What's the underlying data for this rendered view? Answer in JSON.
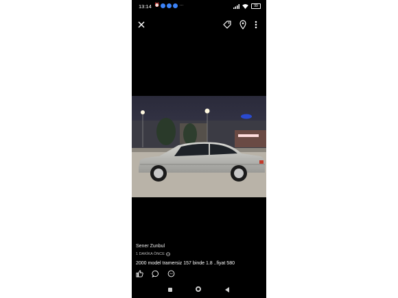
{
  "status_bar": {
    "time": "13:14",
    "battery": "99",
    "more_dots": "···"
  },
  "post": {
    "author": "Sener Zunbul",
    "timestamp": "1 DAKİKA ÖNCE",
    "caption": "2000 model tramersiz 157 binde 1.8 ..fiyat 580"
  },
  "icons": {
    "close": "close-icon",
    "tag": "tag-icon",
    "location": "location-pin-icon",
    "more": "more-vertical-icon",
    "like": "thumbs-up-icon",
    "comment": "comment-icon",
    "share": "messenger-icon"
  },
  "colors": {
    "background": "#000000",
    "notification_accent": "#3b82f6"
  }
}
